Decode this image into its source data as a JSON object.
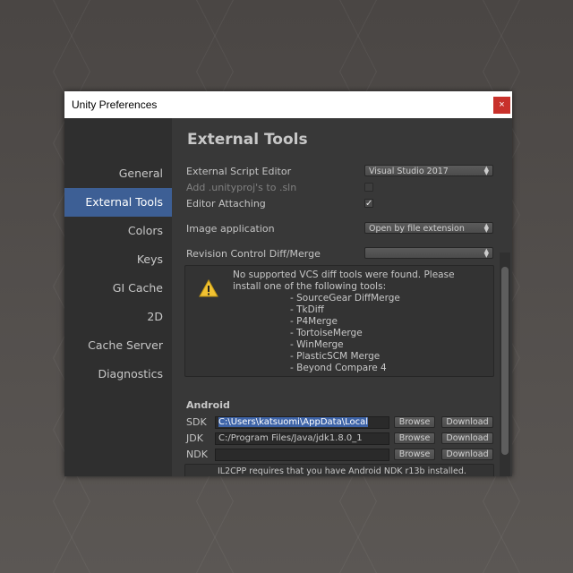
{
  "window": {
    "title": "Unity Preferences",
    "close": "×"
  },
  "sidebar": {
    "items": [
      {
        "label": "General",
        "active": false
      },
      {
        "label": "External Tools",
        "active": true
      },
      {
        "label": "Colors",
        "active": false
      },
      {
        "label": "Keys",
        "active": false
      },
      {
        "label": "GI Cache",
        "active": false
      },
      {
        "label": "2D",
        "active": false
      },
      {
        "label": "Cache Server",
        "active": false
      },
      {
        "label": "Diagnostics",
        "active": false
      }
    ]
  },
  "main": {
    "heading": "External Tools",
    "script_editor": {
      "label": "External Script Editor",
      "value": "Visual Studio 2017"
    },
    "add_unityproj": {
      "label": "Add .unityproj's to .sln",
      "checked": false,
      "disabled": true
    },
    "editor_attaching": {
      "label": "Editor Attaching",
      "checked": true,
      "mark": "✓"
    },
    "image_app": {
      "label": "Image application",
      "value": "Open by file extension"
    },
    "revision_control": {
      "label": "Revision Control Diff/Merge",
      "value": ""
    },
    "vcs_help": {
      "line1": "No supported VCS diff tools were found. Please",
      "line2": "install one of the following tools:",
      "tools": [
        "- SourceGear DiffMerge",
        "- TkDiff",
        "- P4Merge",
        "- TortoiseMerge",
        "- WinMerge",
        "- PlasticSCM Merge",
        "- Beyond Compare 4"
      ]
    },
    "android": {
      "title": "Android",
      "sdk": {
        "label": "SDK",
        "value": "C:\\Users\\katsuomi\\AppData\\Local"
      },
      "jdk": {
        "label": "JDK",
        "value": "C:/Program Files/Java/jdk1.8.0_1"
      },
      "ndk": {
        "label": "NDK",
        "value": ""
      },
      "browse": "Browse",
      "download": "Download",
      "il2cpp_note": "IL2CPP requires that you have Android NDK r13b installed."
    }
  },
  "colors": {
    "accent": "#3d5f95",
    "close": "#c8312b"
  }
}
